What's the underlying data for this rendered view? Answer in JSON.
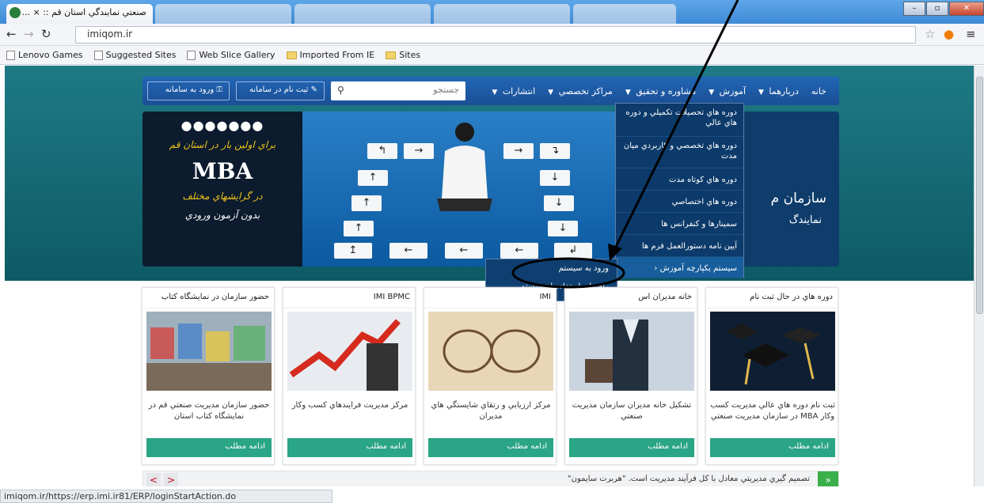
{
  "browser": {
    "tab_title": "صنعتي نمايندگي استان قم :: × ...",
    "address": "imiqom.ir",
    "bookmarks": [
      "Lenovo Games",
      "Suggested Sites",
      "Web Slice Gallery",
      "Imported From IE",
      "Sites"
    ],
    "status_url": "imiqom.ir/https://erp.imi.ir81/ERP/loginStartAction.do"
  },
  "nav": {
    "items": [
      "خانه",
      "دربارهما",
      "آموزش",
      "مشاوره و تحقيق",
      "مراكز تخصصي",
      "انتشارات"
    ],
    "search_placeholder": "جستجو",
    "register_label": "ثبت نام در سامانه",
    "login_label": "ورود به سامانه"
  },
  "dropdown": {
    "items": [
      "دوره هاي تحصيلات تكميلي و دوره هاي عالي",
      "دوره هاي تخصصي و كاربردي ميان مدت",
      "دوره هاي كوتاه مدت",
      "دوره هاي اختصاصي",
      "سمينارها و كنفرانس ها",
      "آيين نامه دستورالعمل فرم ها",
      "سيستم يكپارچه آموزش"
    ],
    "submenu": [
      "ورود به سيستم",
      "راهنماي استفاده از سيستم"
    ]
  },
  "hero": {
    "mba_dots": "●●●●●●●",
    "mba_line1": "براي اولين بار در استان قم",
    "mba_title": "MBA",
    "mba_line2": "در گرايشهاي مختلف",
    "mba_line3": "بدون آزمون ورودي",
    "title": "سازمان م",
    "subtitle": "نمايندگ"
  },
  "cards": [
    {
      "title": "دوره هاي در حال ثبت نام",
      "desc": "ثبت نام دوره هاي عالي مديريت كسب وكار MBA در سازمان مديريت صنعتي",
      "button": "ادامه مطلب"
    },
    {
      "title": "خانه مديران اس",
      "desc": "تشكيل خانه مديران سازمان مديريت صنعتي",
      "button": "ادامه مطلب"
    },
    {
      "title": "IMI",
      "desc": "مركز ارزيابي و رتقاي شايستگي هاي مديران",
      "button": "ادامه مطلب"
    },
    {
      "title": "IMI BPMC",
      "desc": "مركز مديريت فرايندهاي كسب وكار",
      "button": "ادامه مطلب"
    },
    {
      "title": "حضور سازمان در نمايشگاه كتاب",
      "desc": "حضور سازمان مديريت صنعتي قم در نمايشگاه كتاب استان",
      "button": "ادامه مطلب"
    }
  ],
  "ticker": {
    "text": "تصميم گيري مديريتي معادل با كل فرآيند مديريت است. \"هربرت سايمون\"",
    "go": "«",
    "prev": "<",
    "next": ">"
  },
  "colors": {
    "teal": "#1e7a85",
    "navbar": "#1b4f95",
    "green_button": "#2aa585",
    "annotation": "#000000"
  }
}
